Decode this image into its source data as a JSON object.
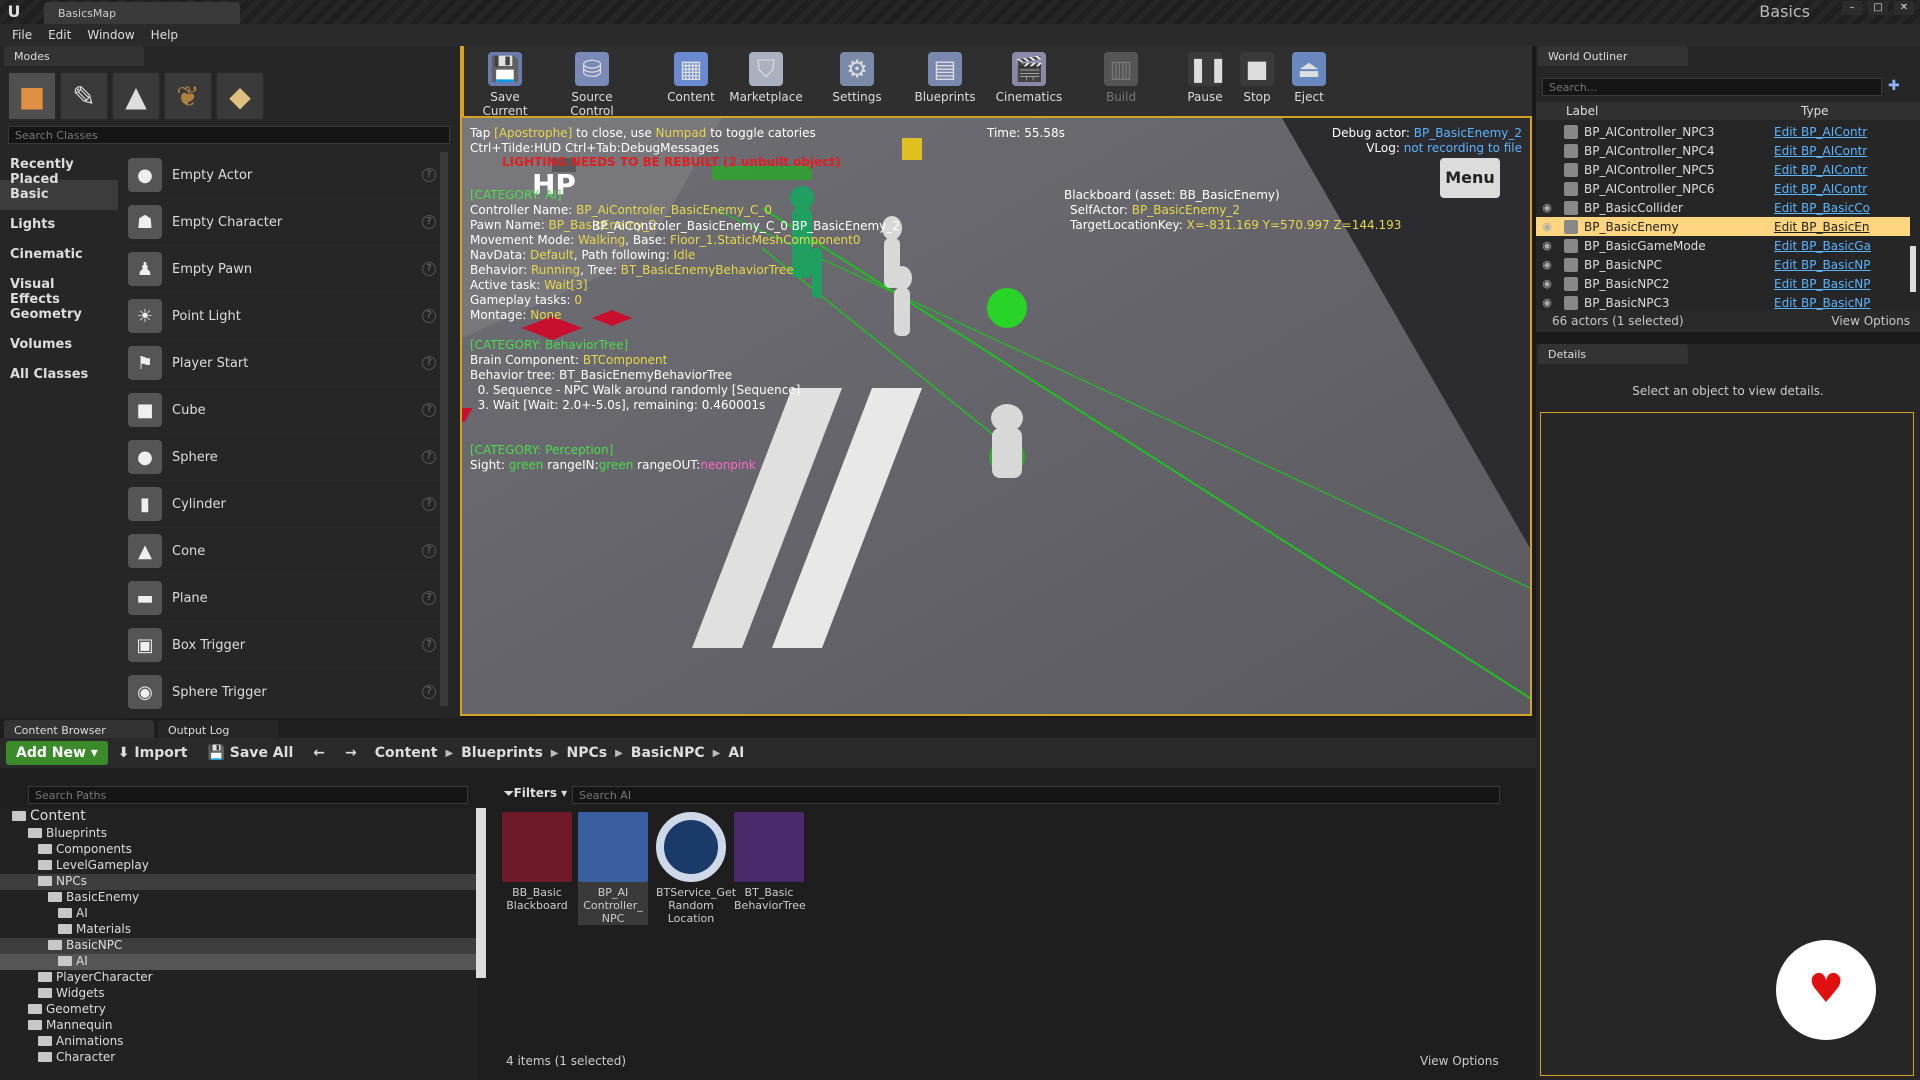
{
  "window": {
    "tab": "BasicsMap",
    "project": "Basics"
  },
  "menu": [
    "File",
    "Edit",
    "Window",
    "Help"
  ],
  "modes": {
    "tab": "Modes",
    "search_placeholder": "Search Classes",
    "categories": [
      "Recently Placed",
      "Basic",
      "Lights",
      "Cinematic",
      "Visual Effects",
      "Geometry",
      "Volumes",
      "All Classes"
    ],
    "items": [
      "Empty Actor",
      "Empty Character",
      "Empty Pawn",
      "Point Light",
      "Player Start",
      "Cube",
      "Sphere",
      "Cylinder",
      "Cone",
      "Plane",
      "Box Trigger",
      "Sphere Trigger"
    ]
  },
  "toolbar": [
    "Save Current",
    "Source Control",
    "Content",
    "Marketplace",
    "Settings",
    "Blueprints",
    "Cinematics",
    "Build",
    "Pause",
    "Stop",
    "Eject"
  ],
  "viewport": {
    "tap_line": [
      "Tap ",
      "[Apostrophe]",
      " to close, use ",
      "Numpad",
      " to toggle catories"
    ],
    "ctrl_line": "Ctrl+Tilde:HUD  Ctrl+Tab:DebugMessages",
    "lighting": "LIGHTING NEEDS TO BE REBUILT (2 unbuilt object)",
    "time": "Time: 55.58s",
    "debug_actor_label": "Debug actor: ",
    "debug_actor": "BP_BasicEnemy_2",
    "vlog_label": "VLog: ",
    "vlog": "not recording to file",
    "hp": "HP",
    "menu": "Menu",
    "cat_ai": "[CATEGORY: AI]",
    "controller_label": "Controller Name: ",
    "controller": "BP_AiControler_BasicEnemy_C_0",
    "pawn_label": "Pawn Name: ",
    "pawn": "BP_BasicEnemy_2",
    "movement_label": "Movement Mode: ",
    "movement": "Walking",
    "base_label": ", Base: ",
    "base": "Floor_1.StaticMeshComponent0",
    "navdata_label": "NavData: ",
    "navdata": "Default",
    "path_label": ", Path following: ",
    "path": "Idle",
    "behavior_label": "Behavior: ",
    "behavior": "Running",
    "tree_label": ", Tree: ",
    "tree": "BT_BasicEnemyBehaviorTree",
    "task_label": "Active task: ",
    "task": "Wait[3]",
    "gameplay_label": "Gameplay tasks: ",
    "gameplay": "0",
    "montage_label": "Montage: ",
    "montage": "None",
    "cat_bt": "[CATEGORY: BehaviorTree]",
    "brain_label": "Brain Component: ",
    "brain": "BTComponent",
    "bt_line": "Behavior tree: BT_BasicEnemyBehaviorTree",
    "seq_line": "  0. Sequence - NPC Walk around randomly [Sequence]",
    "wait_line": "  3. Wait [Wait: 2.0+-5.0s], remaining: 0.460001s",
    "cat_perception": "[CATEGORY: Perception]",
    "sight_label": "Sight: ",
    "sight_green": "green",
    "range_in_label": " rangeIN:",
    "range_in": "green",
    "range_out_label": " rangeOUT:",
    "range_out": "neonpink",
    "blackboard": "Blackboard (asset: BB_BasicEnemy)",
    "self_actor_label": "SelfActor: ",
    "self_actor": "BP_BasicEnemy_2",
    "target_label": "TargetLocationKey: ",
    "target": "X=-831.169 Y=570.997 Z=144.193",
    "overlap_label": "BP_AiControler_BasicEnemy_C_0 BP_BasicEnemy_2"
  },
  "outliner": {
    "tab": "World Outliner",
    "search_placeholder": "Search...",
    "col_label": "Label",
    "col_type": "Type",
    "rows": [
      {
        "name": "BP_AIController_NPC3",
        "type": "Edit BP_AIContr"
      },
      {
        "name": "BP_AIController_NPC4",
        "type": "Edit BP_AIContr"
      },
      {
        "name": "BP_AIController_NPC5",
        "type": "Edit BP_AIContr"
      },
      {
        "name": "BP_AIController_NPC6",
        "type": "Edit BP_AIContr"
      },
      {
        "name": "BP_BasicCollider",
        "type": "Edit BP_BasicCo"
      },
      {
        "name": "BP_BasicEnemy",
        "type": "Edit BP_BasicEn"
      },
      {
        "name": "BP_BasicGameMode",
        "type": "Edit BP_BasicGa"
      },
      {
        "name": "BP_BasicNPC",
        "type": "Edit BP_BasicNP"
      },
      {
        "name": "BP_BasicNPC2",
        "type": "Edit BP_BasicNP"
      },
      {
        "name": "BP_BasicNPC3",
        "type": "Edit BP_BasicNP"
      }
    ],
    "count": "66 actors (1 selected)",
    "view_options": "View Options"
  },
  "details": {
    "tab": "Details",
    "empty": "Select an object to view details."
  },
  "content_browser": {
    "tab": "Content Browser",
    "tab2": "Output Log",
    "add_new": "Add New",
    "import": "Import",
    "save_all": "Save All",
    "crumbs": [
      "Content",
      "Blueprints",
      "NPCs",
      "BasicNPC",
      "AI"
    ],
    "search_paths": "Search Paths",
    "filters": "Filters",
    "search_assets": "Search AI",
    "tree": [
      {
        "label": "Content",
        "depth": 0
      },
      {
        "label": "Blueprints",
        "depth": 1
      },
      {
        "label": "Components",
        "depth": 2
      },
      {
        "label": "LevelGameplay",
        "depth": 2
      },
      {
        "label": "NPCs",
        "depth": 2
      },
      {
        "label": "BasicEnemy",
        "depth": 3
      },
      {
        "label": "AI",
        "depth": 4
      },
      {
        "label": "Materials",
        "depth": 4
      },
      {
        "label": "BasicNPC",
        "depth": 3
      },
      {
        "label": "AI",
        "depth": 4
      },
      {
        "label": "PlayerCharacter",
        "depth": 2
      },
      {
        "label": "Widgets",
        "depth": 2
      },
      {
        "label": "Geometry",
        "depth": 1
      },
      {
        "label": "Mannequin",
        "depth": 1
      },
      {
        "label": "Animations",
        "depth": 2
      },
      {
        "label": "Character",
        "depth": 2
      }
    ],
    "assets": [
      {
        "label": "BB_Basic Blackboard"
      },
      {
        "label": "BP_AI Controller_ NPC"
      },
      {
        "label": "BTService_Get Random Location"
      },
      {
        "label": "BT_Basic BehaviorTree"
      }
    ],
    "status": "4 items (1 selected)",
    "view_options": "View Options"
  }
}
